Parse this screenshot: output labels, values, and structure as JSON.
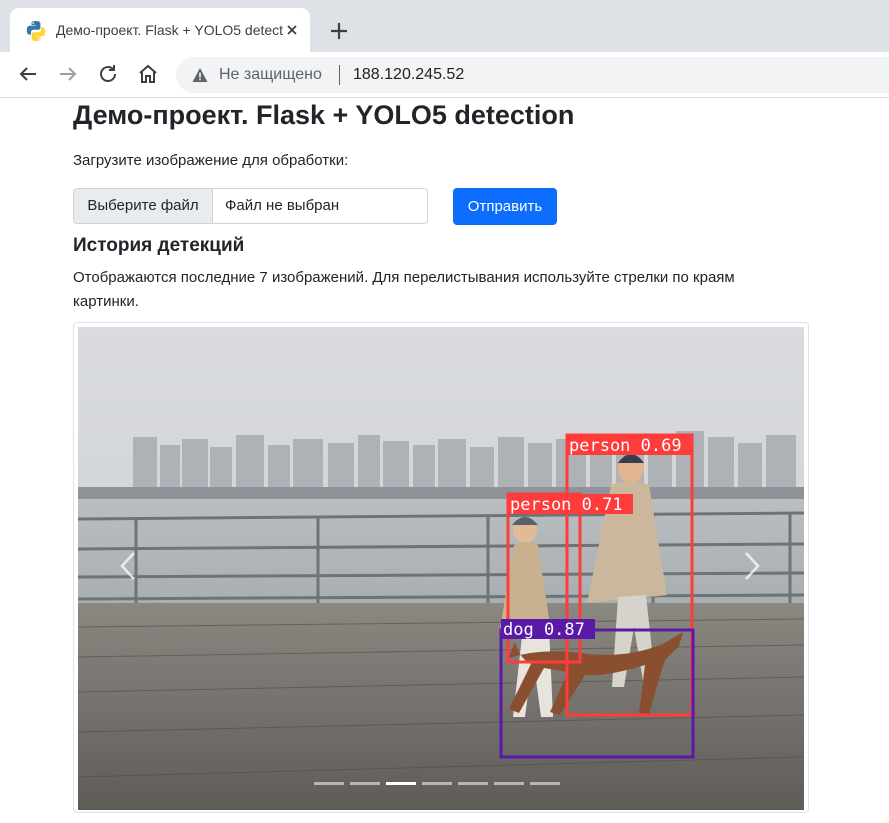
{
  "browser": {
    "tab_title": "Демо-проект. Flask + YOLO5 detection",
    "security_text": "Не защищено",
    "url": "188.120.245.52"
  },
  "page": {
    "title": "Демо-проект. Flask + YOLO5 detection",
    "upload_prompt": "Загрузите изображение для обработки:",
    "file_button_label": "Выберите файл",
    "file_status": "Файл не выбран",
    "submit_label": "Отправить",
    "history_title": "История детекций",
    "history_description": "Отображаются последние 7 изображений. Для перелистывания используйте стрелки по краям картинки."
  },
  "carousel": {
    "slide_count": 7,
    "active_index": 2,
    "detections": [
      {
        "label": "person 0.69",
        "color": "#ff3b3b"
      },
      {
        "label": "person 0.71",
        "color": "#ff3b3b"
      },
      {
        "label": "dog 0.87",
        "color": "#5a19a8"
      }
    ]
  },
  "icons": {
    "tab_favicon": "python-logo-icon",
    "tab_close": "close-icon",
    "new_tab": "plus-icon",
    "back": "arrow-left-icon",
    "forward": "arrow-right-icon",
    "reload": "reload-icon",
    "home": "home-icon",
    "security": "warning-icon",
    "prev": "chevron-left-icon",
    "next": "chevron-right-icon"
  }
}
